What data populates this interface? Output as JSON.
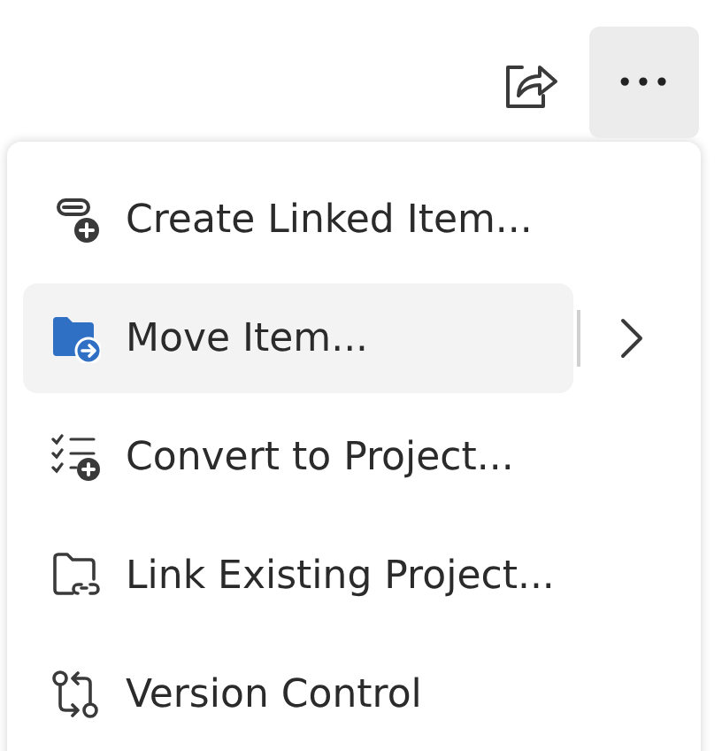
{
  "toolbar": {
    "more_button": {
      "label": "•••",
      "selected": true
    }
  },
  "menu": {
    "items": [
      {
        "label": "Create Linked Item...",
        "kind": "plain",
        "selected": false
      },
      {
        "label": "Move Item...",
        "kind": "submenu",
        "selected": true
      },
      {
        "label": "Convert to Project...",
        "kind": "plain",
        "selected": false
      },
      {
        "label": "Link Existing Project...",
        "kind": "plain",
        "selected": false
      },
      {
        "label": "Version Control",
        "kind": "plain",
        "selected": false
      }
    ]
  }
}
